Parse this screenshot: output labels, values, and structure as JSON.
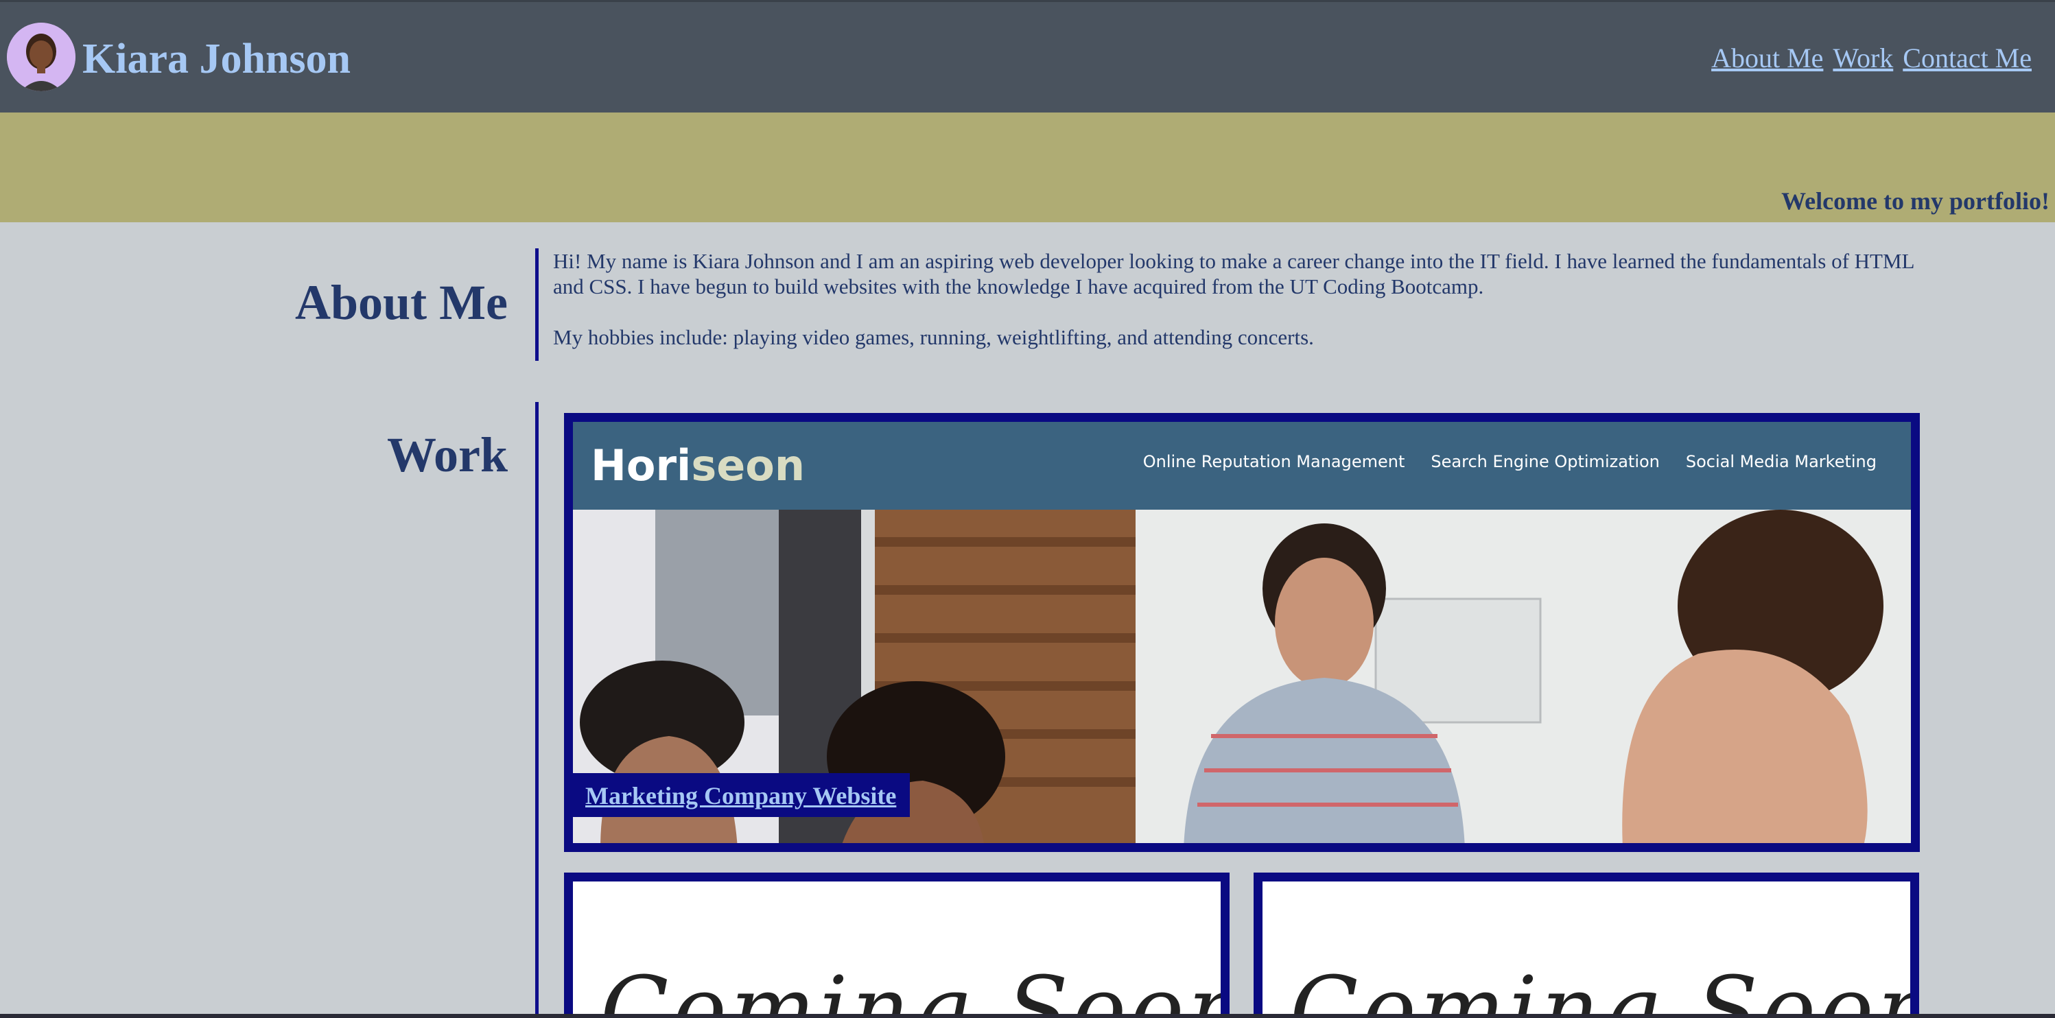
{
  "header": {
    "name": "Kiara Johnson",
    "nav": [
      "About Me",
      "Work",
      "Contact Me"
    ]
  },
  "banner": {
    "welcome": "Welcome to my portfolio!"
  },
  "about": {
    "title": "About Me",
    "paragraphs": [
      "Hi! My name is Kiara Johnson and I am an aspiring web developer looking to make a career change into the IT field. I have learned the fundamentals of HTML and CSS. I have begun to build websites with the knowledge I have acquired from the UT Coding Bootcamp.",
      "My hobbies include: playing video games, running, weightlifting, and attending concerts."
    ]
  },
  "work": {
    "title": "Work",
    "featured": {
      "label": "Marketing Company Website",
      "preview": {
        "logo_main": "Hori",
        "logo_accent": "seon",
        "links": [
          "Online Reputation Management",
          "Search Engine Optimization",
          "Social Media Marketing"
        ]
      }
    },
    "placeholders": [
      "Coming Soon",
      "Coming Soon"
    ]
  },
  "colors": {
    "header_bg": "#4a535e",
    "link": "#a6c8f4",
    "banner_bg": "#afac74",
    "heading": "#23386a",
    "border": "#0a0a82",
    "page_bg": "#c9ced2"
  }
}
